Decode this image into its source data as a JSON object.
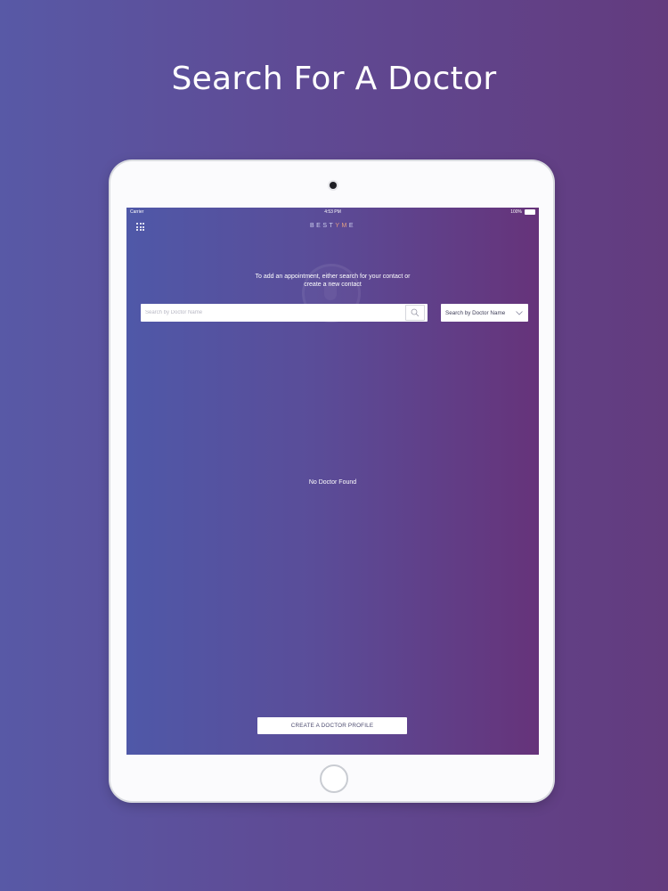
{
  "headline": "Search For A Doctor",
  "device": {
    "status_bar": {
      "carrier": "Carrier",
      "time": "4:53 PM",
      "battery": "100%"
    }
  },
  "app": {
    "logo_prefix": "BEST",
    "logo_accent": "YM",
    "logo_suffix": "E",
    "instructions_line1": "To add an appointment, either search for your contact or",
    "instructions_line2": "create a new contact",
    "search": {
      "placeholder": "Search by Doctor Name",
      "value": ""
    },
    "filter_dropdown": {
      "selected": "Search by Doctor Name"
    },
    "empty_message": "No Doctor Found",
    "create_button_label": "CREATE A DOCTOR PROFILE"
  },
  "colors": {
    "background_left": "#5859a6",
    "background_right": "#633b7e",
    "logo_accent": "#e49f84"
  }
}
